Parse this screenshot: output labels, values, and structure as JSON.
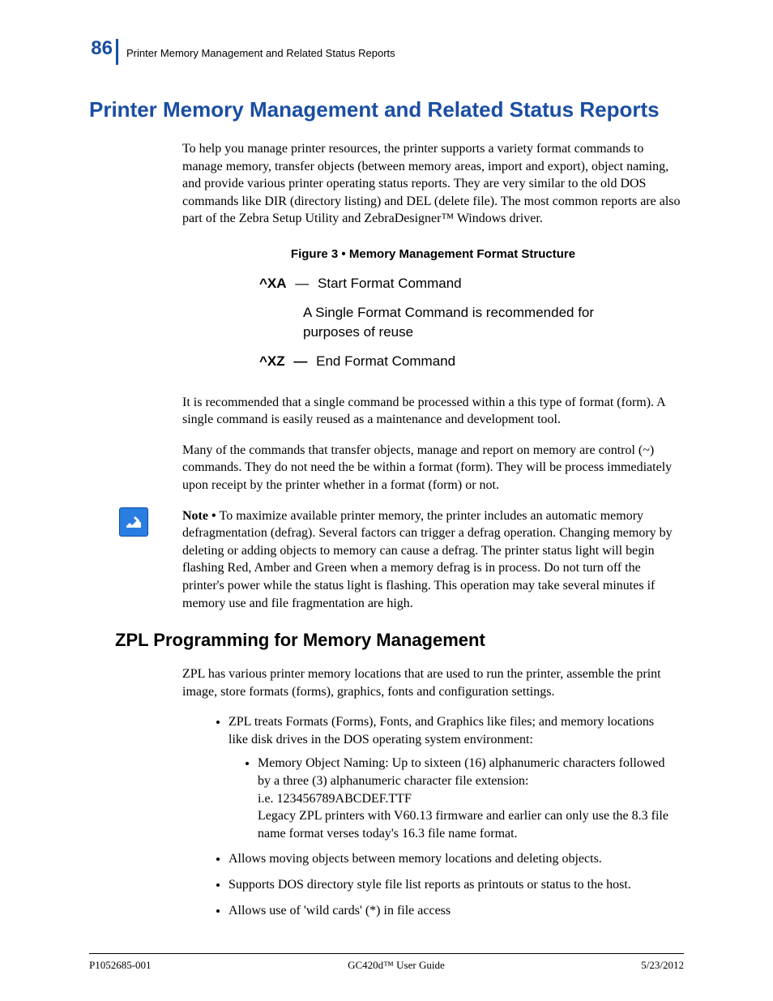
{
  "header": {
    "page_number": "86",
    "running_head": "Printer Memory Management and Related Status Reports"
  },
  "title": "Printer Memory Management and Related Status Reports",
  "intro_paragraph": "To help you manage printer resources, the printer supports a variety format commands to manage memory, transfer objects (between memory areas, import and export), object naming, and provide various printer operating status reports. They are very similar to the old DOS commands like DIR (directory listing) and DEL (delete file). The most common reports are also part of the Zebra Setup Utility and ZebraDesigner™ Windows driver.",
  "figure": {
    "caption": "Figure 3 • Memory Management Format Structure",
    "row1_cmd": "^XA",
    "row1_sep": "—",
    "row1_text": "Start Format Command",
    "indent_text": "A Single Format Command is recommended for purposes of reuse",
    "row2_cmd": "^XZ",
    "row2_sep": "—",
    "row2_text": "End Format Command"
  },
  "para2": "It is recommended that a single command be processed within a this type of format (form). A single command is easily reused as a maintenance and development tool.",
  "para3": "Many of the commands that transfer objects, manage and report on memory are control (~) commands. They do not need the be within a format (form). They will be process immediately upon receipt by the printer whether in a format (form) or not.",
  "note": {
    "label": "Note • ",
    "text": "To maximize available printer memory, the printer includes an automatic memory defragmentation (defrag). Several factors can trigger a defrag operation. Changing memory by deleting or adding objects to memory can cause a defrag. The printer status light will begin flashing Red, Amber and Green when a memory defrag is in process. Do not turn off the printer's power while the status light is flashing. This operation may take several minutes if memory use and file fragmentation are high."
  },
  "subhead": "ZPL Programming for Memory Management",
  "para4": "ZPL has various printer memory locations that are used to run the printer, assemble the print image, store formats (forms), graphics, fonts and configuration settings.",
  "bullets": {
    "b1": "ZPL treats Formats (Forms), Fonts, and Graphics like files; and memory locations like disk drives in the DOS operating system environment:",
    "b1a_line1": "Memory Object Naming: Up to sixteen (16) alphanumeric characters followed by a three (3) alphanumeric character file extension:",
    "b1a_line2": "i.e. 123456789ABCDEF.TTF",
    "b1a_line3": "Legacy ZPL printers with V60.13 firmware and earlier can only use the 8.3 file name format verses today's 16.3 file name format.",
    "b2": "Allows moving objects between memory locations and deleting objects.",
    "b3": "Supports DOS directory style file list reports as printouts or status to the host.",
    "b4": "Allows use of 'wild cards' (*) in file access"
  },
  "footer": {
    "left": "P1052685-001",
    "center": "GC420d™ User Guide",
    "right": "5/23/2012"
  }
}
